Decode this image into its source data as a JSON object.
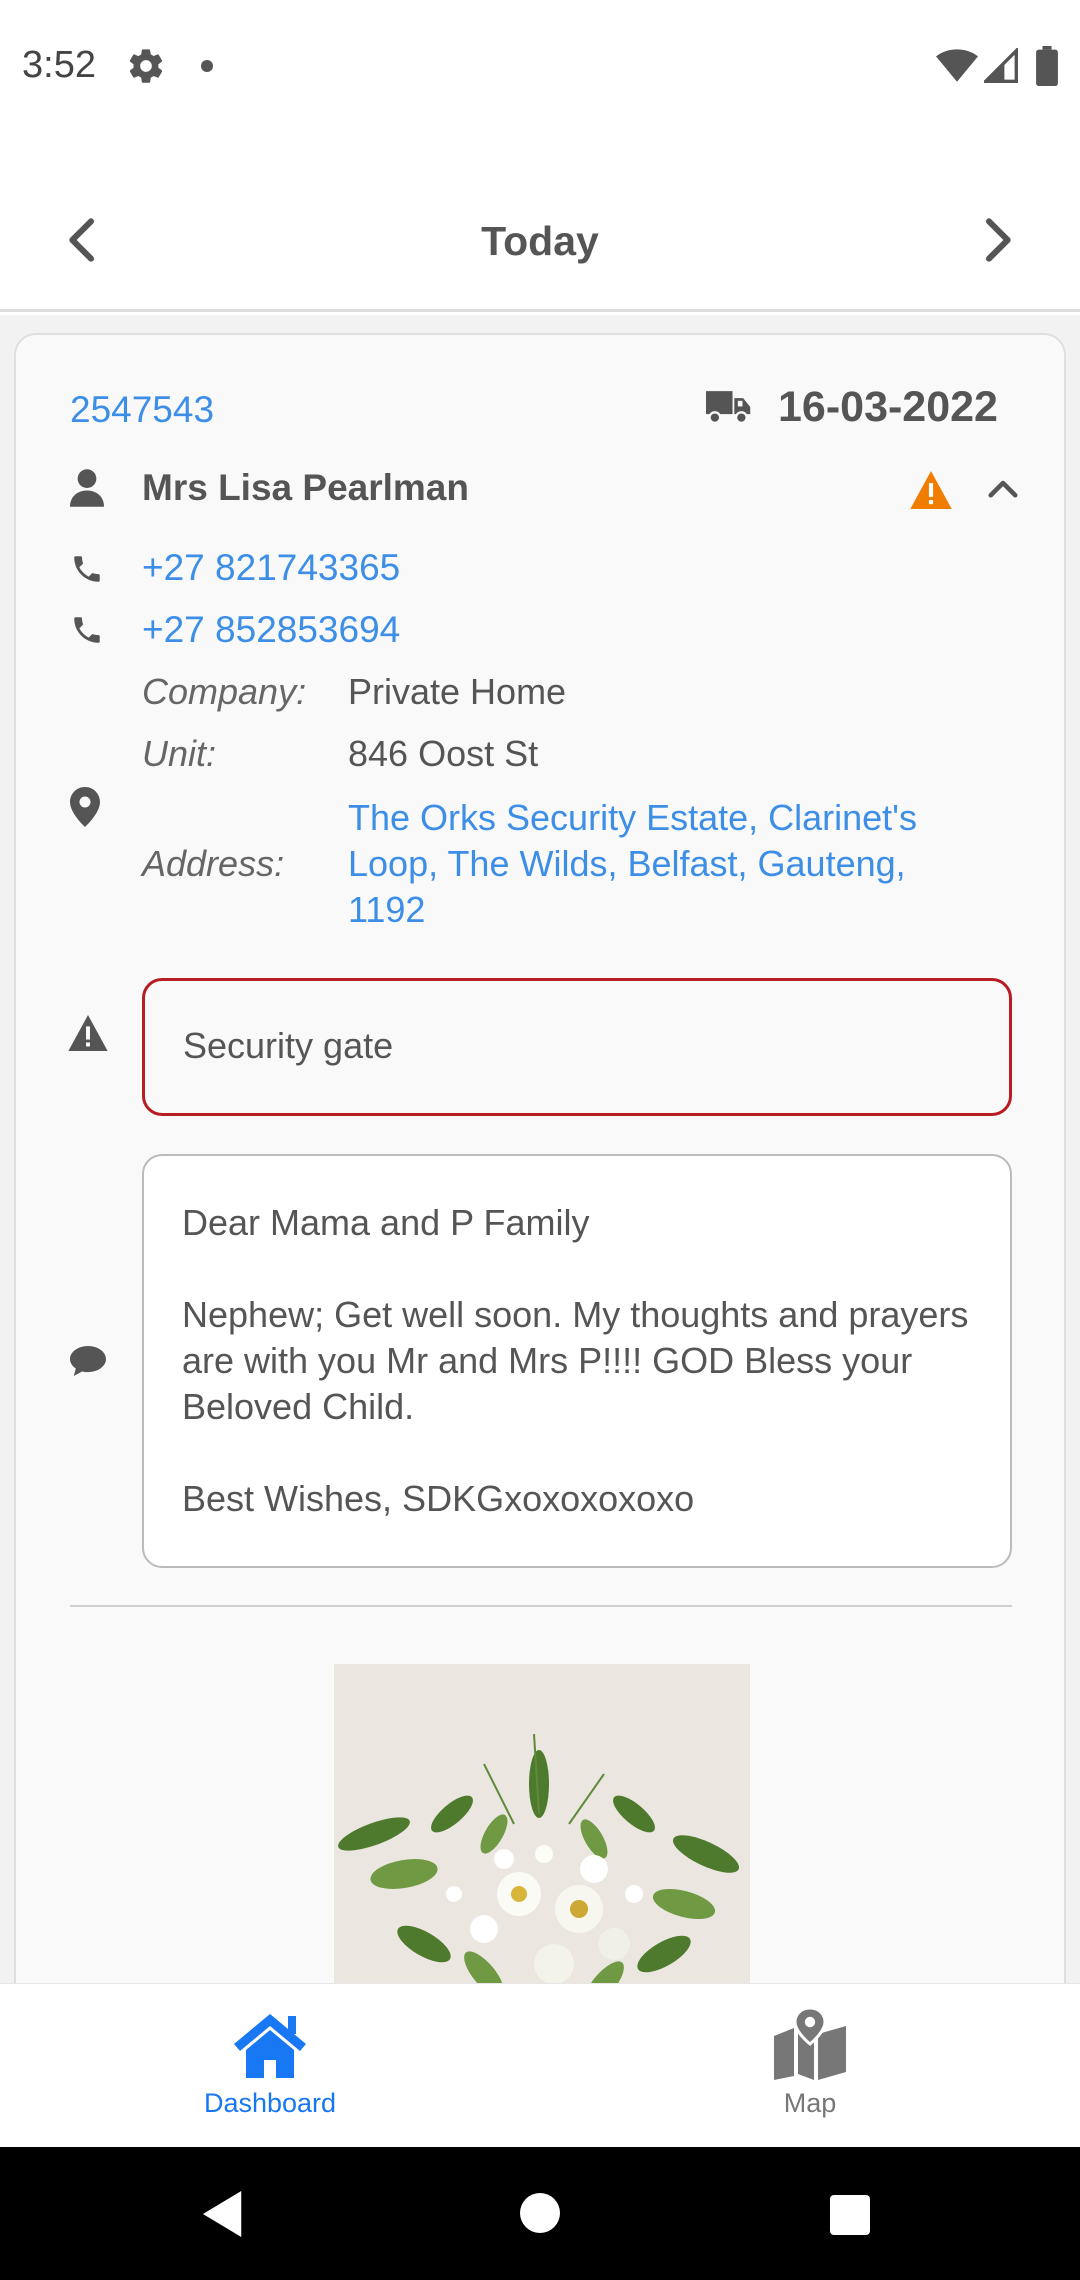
{
  "status_bar": {
    "time": "3:52",
    "icons": [
      "gear-icon",
      "notification-dot-icon",
      "wifi-icon",
      "signal-icon",
      "battery-icon"
    ]
  },
  "header": {
    "title": "Today",
    "prev_icon": "chevron-left-icon",
    "next_icon": "chevron-right-icon"
  },
  "order": {
    "id": "2547543",
    "delivery_icon": "truck-icon",
    "date": "16-03-2022",
    "customer_name": "Mrs Lisa Pearlman",
    "alert_icon": "warning-icon",
    "alert_color": "#f07c00",
    "collapse_icon": "chevron-up-icon",
    "phones": [
      "+27 821743365",
      "+27 852853694"
    ],
    "company_label": "Company:",
    "company_value": "Private Home",
    "unit_label": "Unit:",
    "unit_value": "846 Oost St",
    "address_label": "Address:",
    "address_value": "The Orks Security Estate, Clarinet's Loop, The Wilds, Belfast, Gauteng, 1192",
    "delivery_instruction": "Security gate",
    "instruction_border_color": "#b81c23",
    "card_message": "Dear Mama and P Family\n\nNephew; Get well soon. My thoughts and prayers are with you Mr and Mrs P!!!! GOD Bless your Beloved Child.\n\nBest Wishes, SDKGxoxoxoxoxo"
  },
  "bottom_nav": {
    "items": [
      {
        "label": "Dashboard",
        "icon": "home-icon",
        "active": true
      },
      {
        "label": "Map",
        "icon": "map-icon",
        "active": false
      }
    ],
    "active_color": "#1877f2",
    "inactive_color": "#777777"
  },
  "colors": {
    "link": "#3d8ee6",
    "text": "#555555"
  }
}
